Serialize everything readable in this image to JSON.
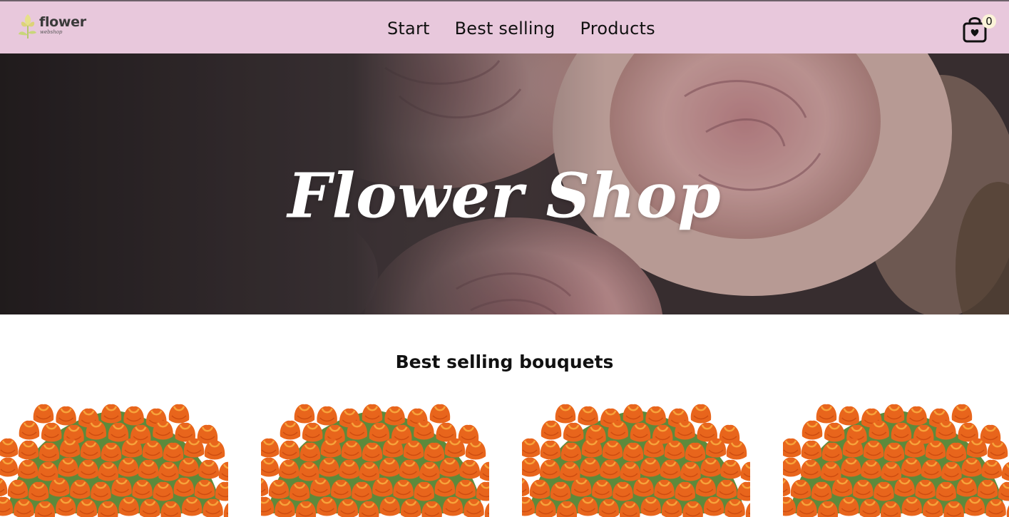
{
  "brand": {
    "name": "flower",
    "tagline": "webshop"
  },
  "nav": {
    "links": [
      "Start",
      "Best selling",
      "Products"
    ]
  },
  "cart": {
    "count": "0",
    "icon": "shopping-bag-heart-icon"
  },
  "hero": {
    "title": "Flower Shop"
  },
  "best_selling": {
    "title": "Best selling bouquets",
    "items": [
      {
        "image": "orange-tulip-bouquet"
      },
      {
        "image": "orange-tulip-bouquet"
      },
      {
        "image": "orange-tulip-bouquet"
      },
      {
        "image": "orange-tulip-bouquet"
      }
    ]
  },
  "colors": {
    "navbar": "#e8c8dc",
    "hero_title": "#ffffff",
    "cart_badge": "#fbf3d8"
  }
}
